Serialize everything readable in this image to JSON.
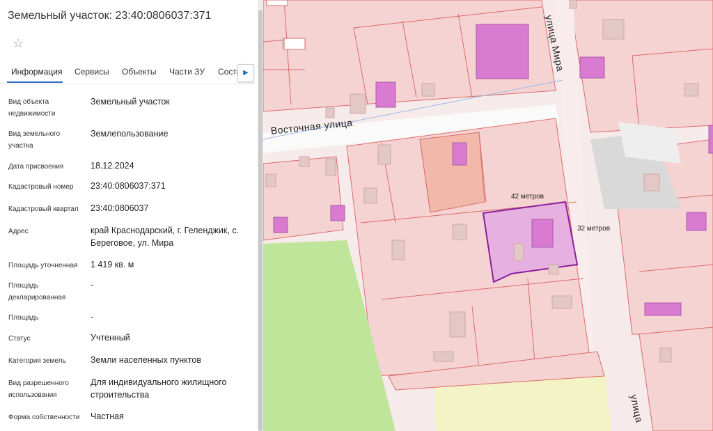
{
  "header": {
    "title": "Земельный участок: 23:40:0806037:371"
  },
  "tabs": [
    {
      "label": "Информация",
      "active": true
    },
    {
      "label": "Сервисы",
      "active": false
    },
    {
      "label": "Объекты",
      "active": false
    },
    {
      "label": "Части ЗУ",
      "active": false
    },
    {
      "label": "Соста",
      "active": false
    }
  ],
  "info": [
    {
      "label": "Вид объекта недвижимости",
      "value": "Земельный участок"
    },
    {
      "label": "Вид земельного участка",
      "value": "Землепользование"
    },
    {
      "label": "Дата присвоения",
      "value": "18.12.2024"
    },
    {
      "label": "Кадастровый номер",
      "value": "23:40:0806037:371"
    },
    {
      "label": "Кадастровый квартал",
      "value": "23:40:0806037"
    },
    {
      "label": "Адрес",
      "value": "край Краснодарский, г. Геленджик, с. Береговое, ул. Мира"
    },
    {
      "label": "Площадь уточненная",
      "value": "1 419 кв. м"
    },
    {
      "label": "Площадь декларированная",
      "value": "-"
    },
    {
      "label": "Площадь",
      "value": "-"
    },
    {
      "label": "Статус",
      "value": "Учтенный"
    },
    {
      "label": "Категория земель",
      "value": "Земли населенных пунктов"
    },
    {
      "label": "Вид разрешенного использования",
      "value": "Для индивидуального жилищного строительства"
    },
    {
      "label": "Форма собственности",
      "value": "Частная"
    }
  ],
  "map": {
    "street_vostochnaya": "Восточная  улица",
    "street_mira": "улица Мира",
    "street_bottom": "улица",
    "dim_width": "42 метров",
    "dim_height": "32 метров",
    "colors": {
      "parcel_fill": "#f6d3d3",
      "parcel_border": "#d96a6a",
      "building": "#d97bd0",
      "selected_fill": "#e3a9e3",
      "selected_border": "#8a1f9a",
      "green": "#bfe59a",
      "yellow": "#f4f3c6",
      "road": "#f7eaea"
    }
  },
  "icons": {
    "favorite": "star-outline-icon",
    "next": "chevron-right-icon"
  }
}
